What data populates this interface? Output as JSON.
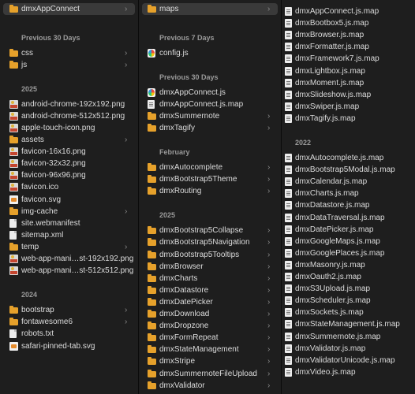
{
  "column1": {
    "header": {
      "label": "dmxAppConnect",
      "icon": "folder-icon"
    },
    "sections": [
      {
        "title": "Previous 30 Days",
        "items": [
          {
            "label": "css",
            "icon": "folder",
            "chevron": true
          },
          {
            "label": "js",
            "icon": "folder",
            "chevron": true
          }
        ]
      },
      {
        "title": "2025",
        "items": [
          {
            "label": "android-chrome-192x192.png",
            "icon": "image"
          },
          {
            "label": "android-chrome-512x512.png",
            "icon": "image"
          },
          {
            "label": "apple-touch-icon.png",
            "icon": "image"
          },
          {
            "label": "assets",
            "icon": "folder",
            "chevron": true
          },
          {
            "label": "favicon-16x16.png",
            "icon": "image"
          },
          {
            "label": "favicon-32x32.png",
            "icon": "image"
          },
          {
            "label": "favicon-96x96.png",
            "icon": "image"
          },
          {
            "label": "favicon.ico",
            "icon": "image"
          },
          {
            "label": "favicon.svg",
            "icon": "svg"
          },
          {
            "label": "img-cache",
            "icon": "folder",
            "chevron": true
          },
          {
            "label": "site.webmanifest",
            "icon": "file"
          },
          {
            "label": "sitemap.xml",
            "icon": "file"
          },
          {
            "label": "temp",
            "icon": "folder",
            "chevron": true
          },
          {
            "label": "web-app-mani…st-192x192.png",
            "icon": "image"
          },
          {
            "label": "web-app-mani…st-512x512.png",
            "icon": "image"
          }
        ]
      },
      {
        "title": "2024",
        "items": [
          {
            "label": "bootstrap",
            "icon": "folder",
            "chevron": true
          },
          {
            "label": "fontawesome6",
            "icon": "folder",
            "chevron": true
          },
          {
            "label": "robots.txt",
            "icon": "file"
          },
          {
            "label": "safari-pinned-tab.svg",
            "icon": "svg"
          }
        ]
      }
    ]
  },
  "column2": {
    "header": {
      "label": "maps",
      "icon": "folder-icon"
    },
    "sections": [
      {
        "title": "Previous 7 Days",
        "items": [
          {
            "label": "config.js",
            "icon": "js"
          }
        ]
      },
      {
        "title": "Previous 30 Days",
        "items": [
          {
            "label": "dmxAppConnect.js",
            "icon": "js"
          },
          {
            "label": "dmxAppConnect.js.map",
            "icon": "doc"
          },
          {
            "label": "dmxSummernote",
            "icon": "folder",
            "chevron": true
          },
          {
            "label": "dmxTagify",
            "icon": "folder",
            "chevron": true
          }
        ]
      },
      {
        "title": "February",
        "items": [
          {
            "label": "dmxAutocomplete",
            "icon": "folder",
            "chevron": true
          },
          {
            "label": "dmxBootstrap5Theme",
            "icon": "folder",
            "chevron": true
          },
          {
            "label": "dmxRouting",
            "icon": "folder",
            "chevron": true
          }
        ]
      },
      {
        "title": "2025",
        "items": [
          {
            "label": "dmxBootstrap5Collapse",
            "icon": "folder",
            "chevron": true
          },
          {
            "label": "dmxBootstrap5Navigation",
            "icon": "folder",
            "chevron": true
          },
          {
            "label": "dmxBootstrap5Tooltips",
            "icon": "folder",
            "chevron": true
          },
          {
            "label": "dmxBrowser",
            "icon": "folder",
            "chevron": true
          },
          {
            "label": "dmxCharts",
            "icon": "folder",
            "chevron": true
          },
          {
            "label": "dmxDatastore",
            "icon": "folder",
            "chevron": true
          },
          {
            "label": "dmxDatePicker",
            "icon": "folder",
            "chevron": true
          },
          {
            "label": "dmxDownload",
            "icon": "folder",
            "chevron": true
          },
          {
            "label": "dmxDropzone",
            "icon": "folder",
            "chevron": true
          },
          {
            "label": "dmxFormRepeat",
            "icon": "folder",
            "chevron": true
          },
          {
            "label": "dmxStateManagement",
            "icon": "folder",
            "chevron": true
          },
          {
            "label": "dmxStripe",
            "icon": "folder",
            "chevron": true
          },
          {
            "label": "dmxSummernoteFileUpload",
            "icon": "folder",
            "chevron": true
          },
          {
            "label": "dmxValidator",
            "icon": "folder",
            "chevron": true
          }
        ]
      }
    ]
  },
  "column3": {
    "sections": [
      {
        "title": "",
        "items": [
          {
            "label": "dmxAppConnect.js.map",
            "icon": "doc"
          },
          {
            "label": "dmxBootbox5.js.map",
            "icon": "doc"
          },
          {
            "label": "dmxBrowser.js.map",
            "icon": "doc"
          },
          {
            "label": "dmxFormatter.js.map",
            "icon": "doc"
          },
          {
            "label": "dmxFramework7.js.map",
            "icon": "doc"
          },
          {
            "label": "dmxLightbox.js.map",
            "icon": "doc"
          },
          {
            "label": "dmxMoment.js.map",
            "icon": "doc"
          },
          {
            "label": "dmxSlideshow.js.map",
            "icon": "doc"
          },
          {
            "label": "dmxSwiper.js.map",
            "icon": "doc"
          },
          {
            "label": "dmxTagify.js.map",
            "icon": "doc"
          }
        ]
      },
      {
        "title": "2022",
        "items": [
          {
            "label": "dmxAutocomplete.js.map",
            "icon": "doc"
          },
          {
            "label": "dmxBootstrap5Modal.js.map",
            "icon": "doc"
          },
          {
            "label": "dmxCalendar.js.map",
            "icon": "doc"
          },
          {
            "label": "dmxCharts.js.map",
            "icon": "doc"
          },
          {
            "label": "dmxDatastore.js.map",
            "icon": "doc"
          },
          {
            "label": "dmxDataTraversal.js.map",
            "icon": "doc"
          },
          {
            "label": "dmxDatePicker.js.map",
            "icon": "doc"
          },
          {
            "label": "dmxGoogleMaps.js.map",
            "icon": "doc"
          },
          {
            "label": "dmxGooglePlaces.js.map",
            "icon": "doc"
          },
          {
            "label": "dmxMasonry.js.map",
            "icon": "doc"
          },
          {
            "label": "dmxOauth2.js.map",
            "icon": "doc"
          },
          {
            "label": "dmxS3Upload.js.map",
            "icon": "doc"
          },
          {
            "label": "dmxScheduler.js.map",
            "icon": "doc"
          },
          {
            "label": "dmxSockets.js.map",
            "icon": "doc"
          },
          {
            "label": "dmxStateManagement.js.map",
            "icon": "doc"
          },
          {
            "label": "dmxSummernote.js.map",
            "icon": "doc"
          },
          {
            "label": "dmxValidator.js.map",
            "icon": "doc"
          },
          {
            "label": "dmxValidatorUnicode.js.map",
            "icon": "doc"
          },
          {
            "label": "dmxVideo.js.map",
            "icon": "doc"
          }
        ]
      }
    ]
  },
  "glyphs": {
    "chevron": "›"
  },
  "colors": {
    "folder": "#e6a12b",
    "selection": "#3a3a3a",
    "background": "#1e1e1e",
    "section_header": "#9a9a9a"
  }
}
